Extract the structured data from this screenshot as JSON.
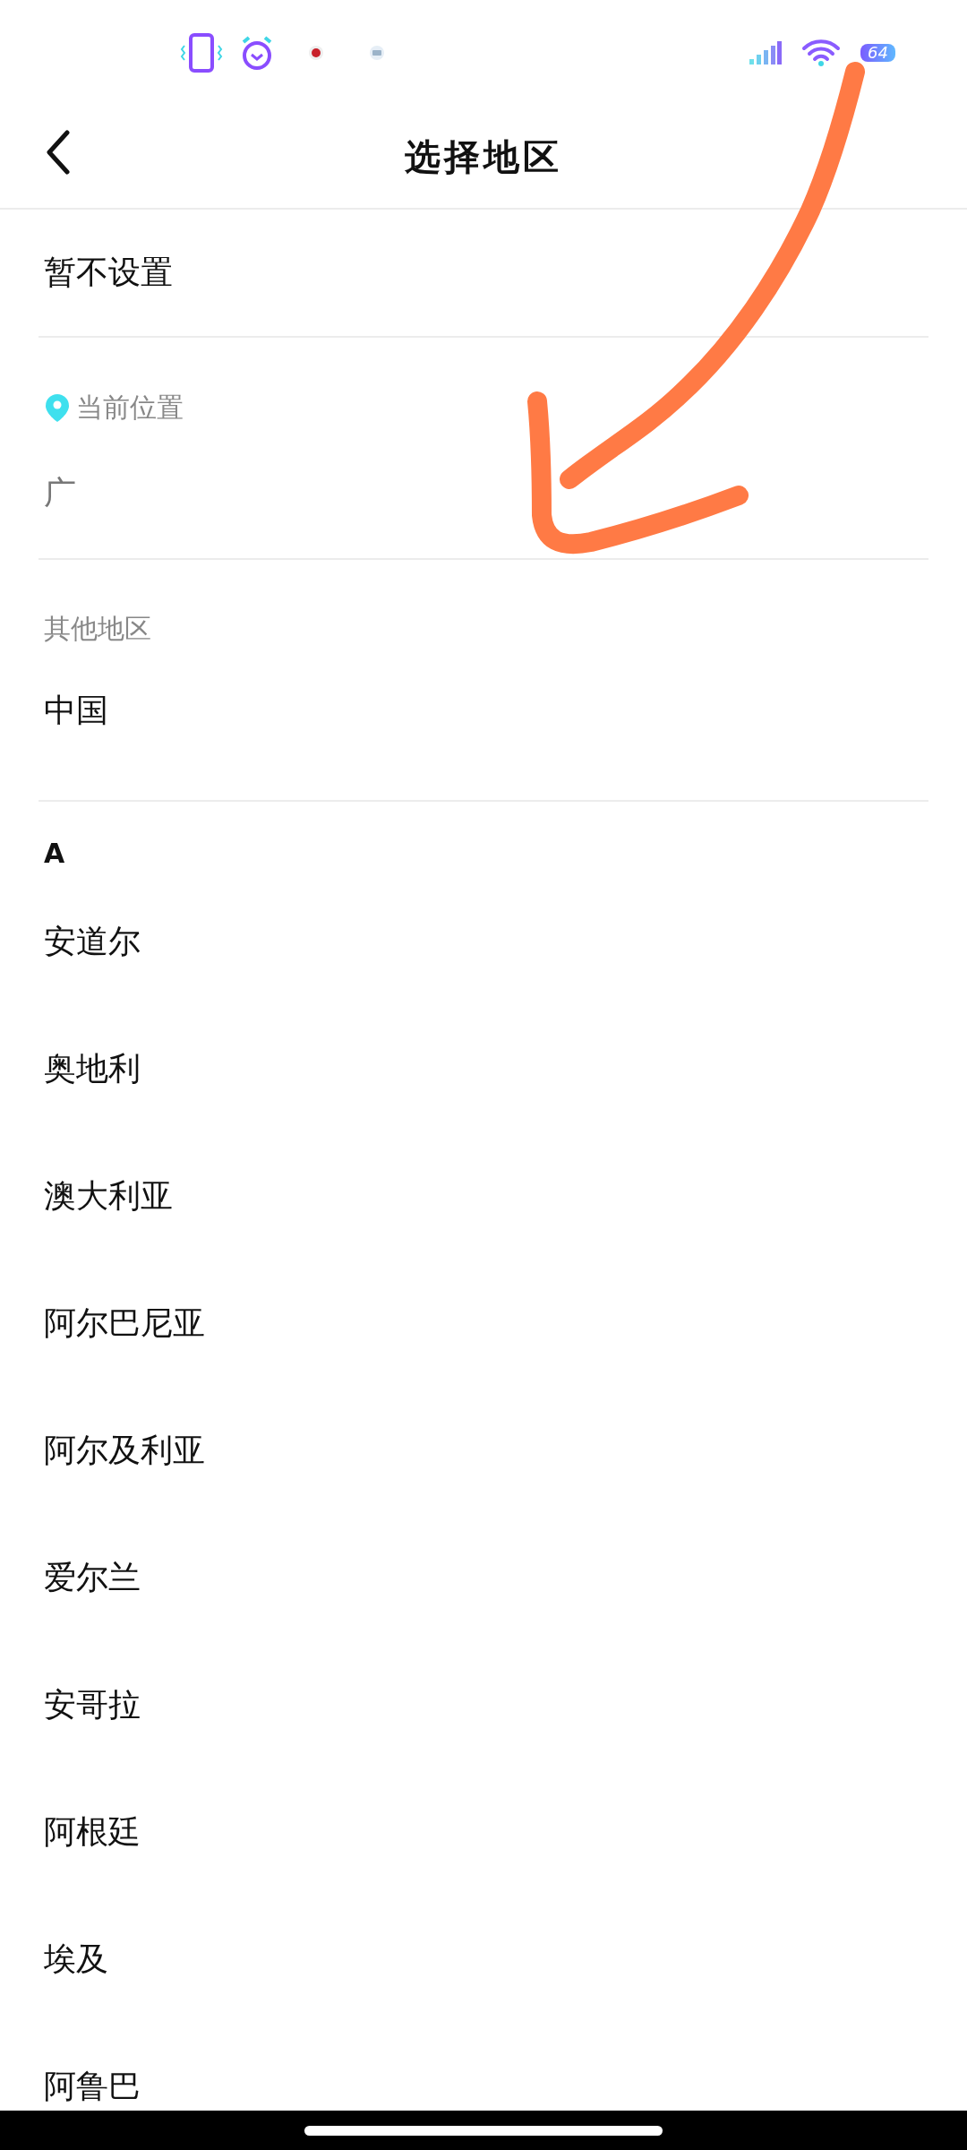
{
  "status_bar": {
    "battery": "64"
  },
  "header": {
    "title": "选择地区"
  },
  "sections": [
    {
      "kind": "plain",
      "rows": [
        {
          "label": "暂不设置"
        }
      ]
    },
    {
      "kind": "location",
      "heading": "当前位置",
      "rows": [
        {
          "label": "广"
        }
      ]
    },
    {
      "kind": "group",
      "heading": "其他地区",
      "rows": [
        {
          "label": "中国"
        }
      ]
    },
    {
      "kind": "letter",
      "heading": "A",
      "rows": [
        {
          "label": "安道尔"
        },
        {
          "label": "奥地利"
        },
        {
          "label": "澳大利亚"
        },
        {
          "label": "阿尔巴尼亚"
        },
        {
          "label": "阿尔及利亚"
        },
        {
          "label": "爱尔兰"
        },
        {
          "label": "安哥拉"
        },
        {
          "label": "阿根廷"
        },
        {
          "label": "埃及"
        },
        {
          "label": "阿鲁巴"
        }
      ]
    }
  ]
}
